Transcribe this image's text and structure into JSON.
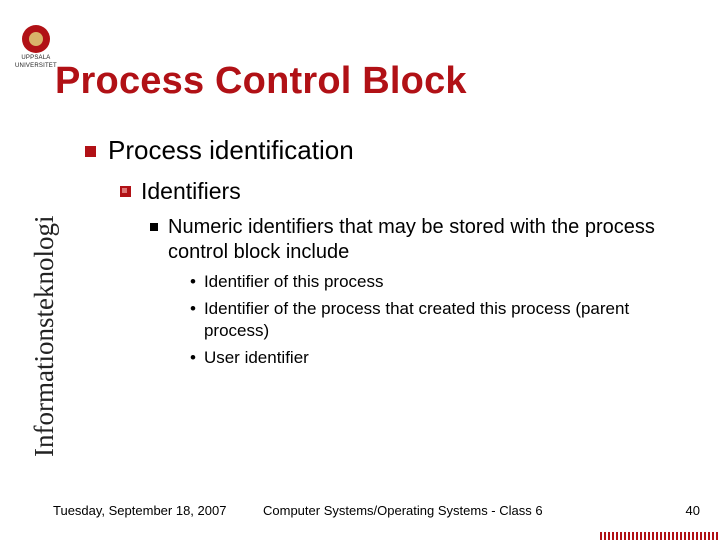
{
  "logo": {
    "line1": "UPPSALA",
    "line2": "UNIVERSITET"
  },
  "title": "Process Control Block",
  "vertical_label": "Informationsteknologi",
  "bullets": {
    "lvl1": "Process identification",
    "lvl2": "Identifiers",
    "lvl3": "Numeric identifiers that may be stored with the process control block include",
    "lvl4": [
      "Identifier of this process",
      "Identifier of the process that created this process (parent process)",
      "User identifier"
    ]
  },
  "footer": {
    "date": "Tuesday, September 18, 2007",
    "center": "Computer Systems/Operating Systems - Class 6",
    "page": "40"
  }
}
